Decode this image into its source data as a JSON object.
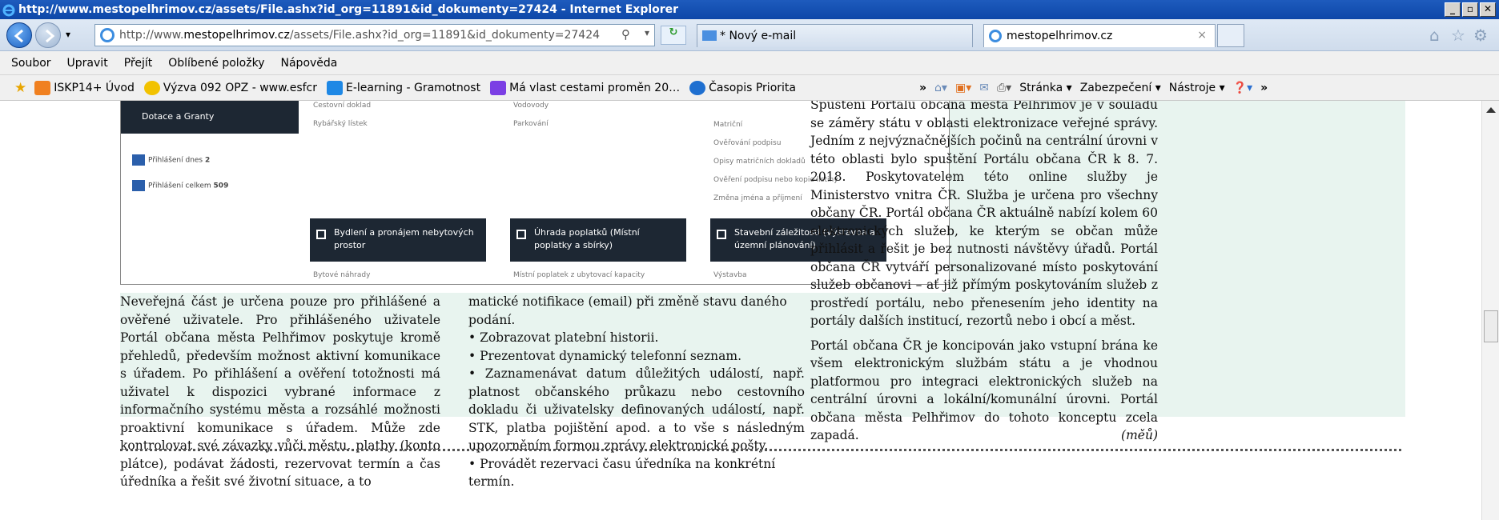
{
  "window": {
    "title": "http://www.mestopelhrimov.cz/assets/File.ashx?id_org=11891&id_dokumenty=27424 - Internet Explorer"
  },
  "address": {
    "prefix": "http://www.",
    "domain": "mestopelhrimov.cz",
    "path": "/assets/File.ashx?id_org=11891&id_dokumenty=27424"
  },
  "tabs": [
    {
      "label": "* Nový e-mail"
    },
    {
      "label": "mestopelhrimov.cz"
    }
  ],
  "menu": [
    "Soubor",
    "Upravit",
    "Přejít",
    "Oblíbené položky",
    "Nápověda"
  ],
  "favorites": [
    {
      "label": "ISKP14+ Úvod",
      "color": "#f08020"
    },
    {
      "label": "Výzva 092 OPZ - www.esfcr",
      "color": "#f2c200"
    },
    {
      "label": "E-learning - Gramotnost",
      "color": "#1e88e5"
    },
    {
      "label": "Má vlast cestami proměn 20…",
      "color": "#7b3fe4"
    },
    {
      "label": "Časopis Priorita",
      "color": "#1e6fd0"
    }
  ],
  "command_bar": [
    "Stránka ▾",
    "Zabezpečení ▾",
    "Nástroje ▾"
  ],
  "doc_screenshot": {
    "sidebar_button": "Dotace a Granty",
    "stats": [
      {
        "label": "Přihlášení dnes",
        "value": "2"
      },
      {
        "label": "Přihlášení celkem",
        "value": "509"
      }
    ],
    "col1": [
      "Cestovní doklad",
      "Rybářský lístek"
    ],
    "col2": [
      "Vodovody",
      "Parkování"
    ],
    "col3": [
      "Matriční",
      "Ověřování podpisu",
      "Opisy matričních dokladů",
      "Ověření podpisu nebo kopie listiny",
      "Změna jména a příjmení"
    ],
    "dark_boxes": [
      "Bydlení a pronájem nebytových prostor",
      "Úhrada poplatků (Místní poplatky a sbírky)",
      "Stavební záležitosti (Výstavba a územní plánování)"
    ],
    "bottom": [
      "Bytové náhrady",
      "Místní poplatek z ubytovací kapacity",
      "Výstavba"
    ]
  },
  "article": {
    "col1": "Neveřejná část je určena pouze pro přihlášené a ověřené uživatele. Pro přihlášeného uživatele Portál občana města Pelhřimov poskytuje kromě přehledů, především možnost aktivní komunikace s úřadem. Po přihlášení a ověření totožnosti má uživatel k dispozici vybrané informace z informačního systému města a rozsáhlé možnosti proaktivní komunikace s úřadem. Může zde kontrolovat své závazky vůči městu, platby (konto plátce), podávat žádosti, rezervovat termín a čas úředníka a řešit své životní situace, a to",
    "col2_lines": [
      "matické notifikace (email) při změně stavu daného podání.",
      "• Zobrazovat platební historii.",
      "• Prezentovat dynamický telefonní seznam.",
      "• Zaznamenávat datum důležitých událostí, např. platnost občanského průkazu nebo cestovního dokladu či uživatelsky definovaných událostí, např. STK, platba pojištění apod. a to vše s následným upozorněním formou zprávy elektronické pošty.",
      "• Provádět rezervaci času úředníka na konkrétní termín."
    ],
    "col3_p1": "Spuštění Portálu občana města Pelhřimov je v souladu se záměry státu v oblasti elektronizace veřejné správy. Jedním z nejvýznačnějších počinů na centrální úrovni v této oblasti bylo spuštění Portálu občana ČR k 8. 7. 2018. Poskytovatelem této online služby je Ministerstvo vnitra ČR. Služba je určena pro všechny občany ČR. Portál občana ČR aktuálně nabízí kolem 60 elektronických služeb, ke kterým se občan může přihlásit a řešit je bez nutnosti návštěvy úřadů. Portál občana ČR vytváří personalizované místo poskytování služeb občanovi – ať již přímým poskytováním služeb z prostředí portálu, nebo přenesením jeho identity na portály dalších institucí, rezortů nebo i obcí a měst.",
    "col3_p2": "Portál občana ČR je koncipován jako vstupní brána ke všem elektronickým službám státu a je vhodnou platformou pro integraci elektronických služeb na centrální úrovni a lokální/komunální úrovni. Portál občana města Pelhřimov do tohoto konceptu zcela zapadá.",
    "signature": "(měů)"
  }
}
